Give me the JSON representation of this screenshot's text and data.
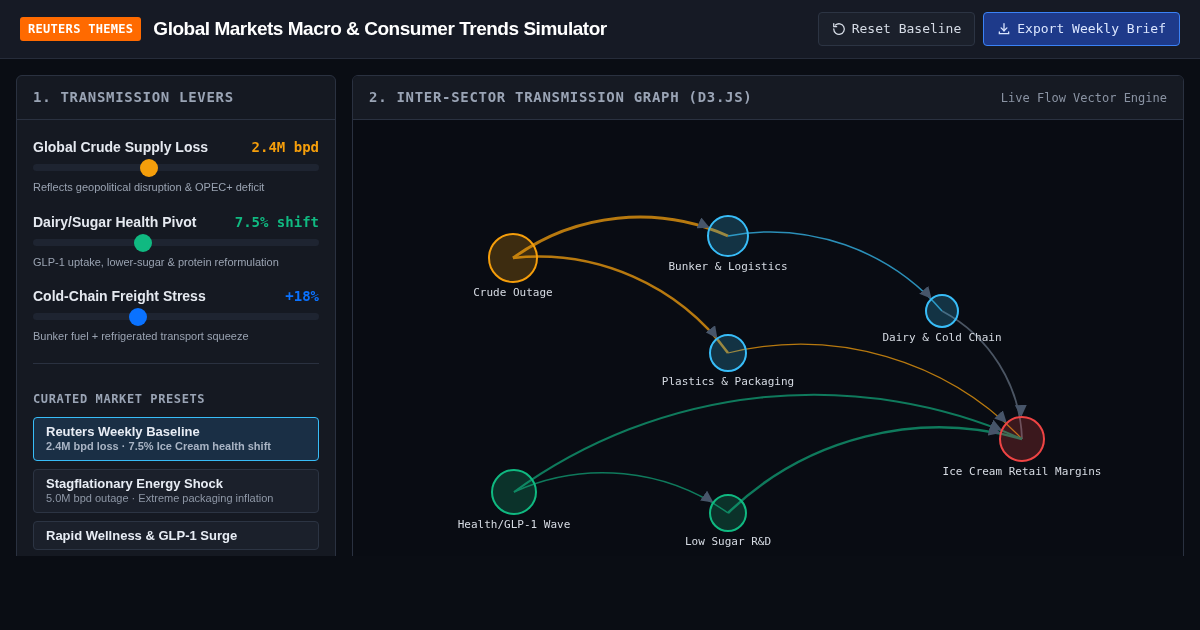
{
  "header": {
    "badge": "REUTERS THEMES",
    "title": "Global Markets Macro & Consumer Trends Simulator",
    "buttons": [
      {
        "kind": "reset",
        "label": "Reset Baseline"
      },
      {
        "kind": "export",
        "label": "Export Weekly Brief"
      }
    ]
  },
  "levers_panel": {
    "title": "1. TRANSMISSION LEVERS",
    "sliders": [
      {
        "label": "Global Crude Supply Loss",
        "reading": "2.4M bpd",
        "color": "#f59e0b",
        "level": 0.405,
        "note": "Reflects geopolitical disruption & OPEC+ deficit"
      },
      {
        "label": "Dairy/Sugar Health Pivot",
        "reading": "7.5% shift",
        "color": "#10b981",
        "level": 0.385,
        "note": "GLP-1 uptake, lower-sugar & protein reformulation"
      },
      {
        "label": "Cold-Chain Freight Stress",
        "reading": "+18%",
        "color": "#0a72ff",
        "level": 0.367,
        "note": "Bunker fuel + refrigerated transport squeeze"
      }
    ],
    "presets_title": "CURATED MARKET PRESETS",
    "presets": [
      {
        "name": "Reuters Weekly Baseline",
        "detail": "2.4M bpd loss · 7.5% Ice Cream health shift",
        "selected": true
      },
      {
        "name": "Stagflationary Energy Shock",
        "detail": "5.0M bpd outage · Extreme packaging inflation",
        "selected": false
      },
      {
        "name": "Rapid Wellness & GLP-1 Surge",
        "selected": false
      }
    ]
  },
  "graph_panel": {
    "title": "2. INTER-SECTOR TRANSMISSION GRAPH (D3.JS)",
    "engine": "Live Flow Vector Engine",
    "nodes": [
      {
        "label": "Crude Outage",
        "color": "#f59e0b"
      },
      {
        "label": "Bunker & Logistics",
        "color": "#38bdf8"
      },
      {
        "label": "Plastics & Packaging",
        "color": "#38bdf8"
      },
      {
        "label": "Dairy & Cold Chain",
        "color": "#38bdf8"
      },
      {
        "label": "Ice Cream Retail Margins",
        "color": "#ef4444"
      },
      {
        "label": "Health/GLP-1 Wave",
        "color": "#10b981"
      },
      {
        "label": "Low Sugar R&D",
        "color": "#10b981"
      }
    ]
  }
}
